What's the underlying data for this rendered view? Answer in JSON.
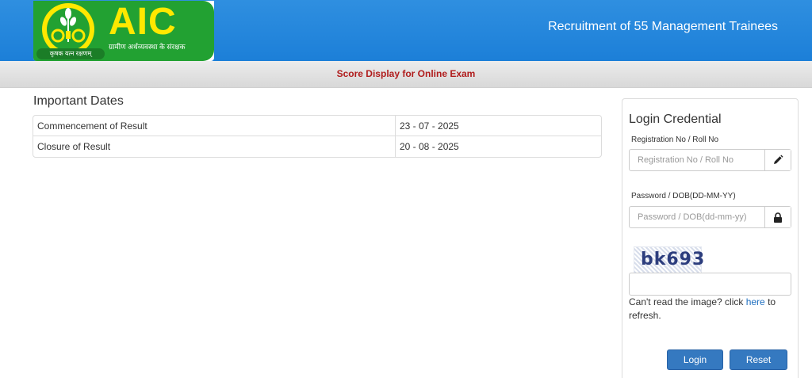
{
  "header": {
    "logo_text": "AIC",
    "logo_tagline": "ग्रामीण अर्थव्यवस्था के संरक्षक",
    "logo_motto": "कृषक यत्न रक्षणम्",
    "title": "Recruitment of 55 Management Trainees"
  },
  "subbar": {
    "title": "Score Display for Online Exam"
  },
  "important_dates": {
    "heading": "Important Dates",
    "rows": [
      {
        "label": "Commencement of Result",
        "value": "23 - 07 - 2025"
      },
      {
        "label": "Closure of Result",
        "value": "20 - 08 - 2025"
      }
    ]
  },
  "login": {
    "title": "Login Credential",
    "reg_label": "Registration No / Roll No",
    "reg_placeholder": "Registration No / Roll No",
    "reg_icon": "pencil-icon",
    "pwd_label": "Password / DOB(DD-MM-YY)",
    "pwd_placeholder": "Password / DOB(dd-mm-yy)",
    "pwd_icon": "lock-icon",
    "captcha_text": "bk693",
    "captcha_value": "",
    "refresh_prefix": "Can't read the image? click ",
    "refresh_link": "here",
    "refresh_suffix": " to refresh.",
    "login_label": "Login",
    "reset_label": "Reset"
  },
  "colors": {
    "header_blue": "#1c7fd8",
    "logo_green": "#22a132",
    "logo_yellow": "#ffe800",
    "subbar_title_red": "#b01c1c",
    "button_blue": "#3579c0"
  }
}
